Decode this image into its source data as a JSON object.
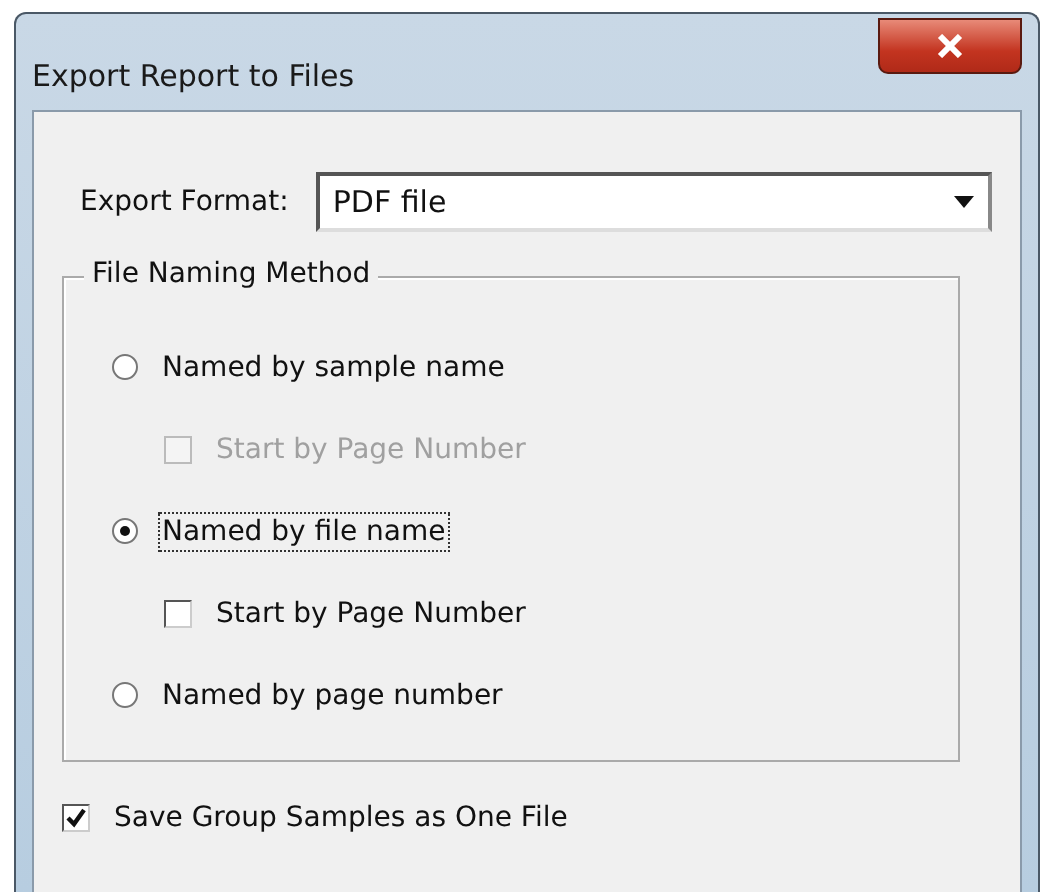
{
  "window": {
    "title": "Export Report to Files"
  },
  "export_format": {
    "label": "Export Format:",
    "value": "PDF file"
  },
  "naming_group": {
    "title": "File Naming Method",
    "options": [
      {
        "kind": "radio",
        "label": "Named by sample name",
        "selected": false,
        "disabled": false
      },
      {
        "kind": "checkbox",
        "label": "Start by Page Number",
        "checked": false,
        "disabled": true
      },
      {
        "kind": "radio",
        "label": "Named by file name",
        "selected": true,
        "disabled": false
      },
      {
        "kind": "checkbox",
        "label": "Start by Page Number",
        "checked": false,
        "disabled": false
      },
      {
        "kind": "radio",
        "label": "Named by page number",
        "selected": false,
        "disabled": false
      }
    ]
  },
  "save_group": {
    "label": "Save Group Samples as One File",
    "checked": true
  }
}
